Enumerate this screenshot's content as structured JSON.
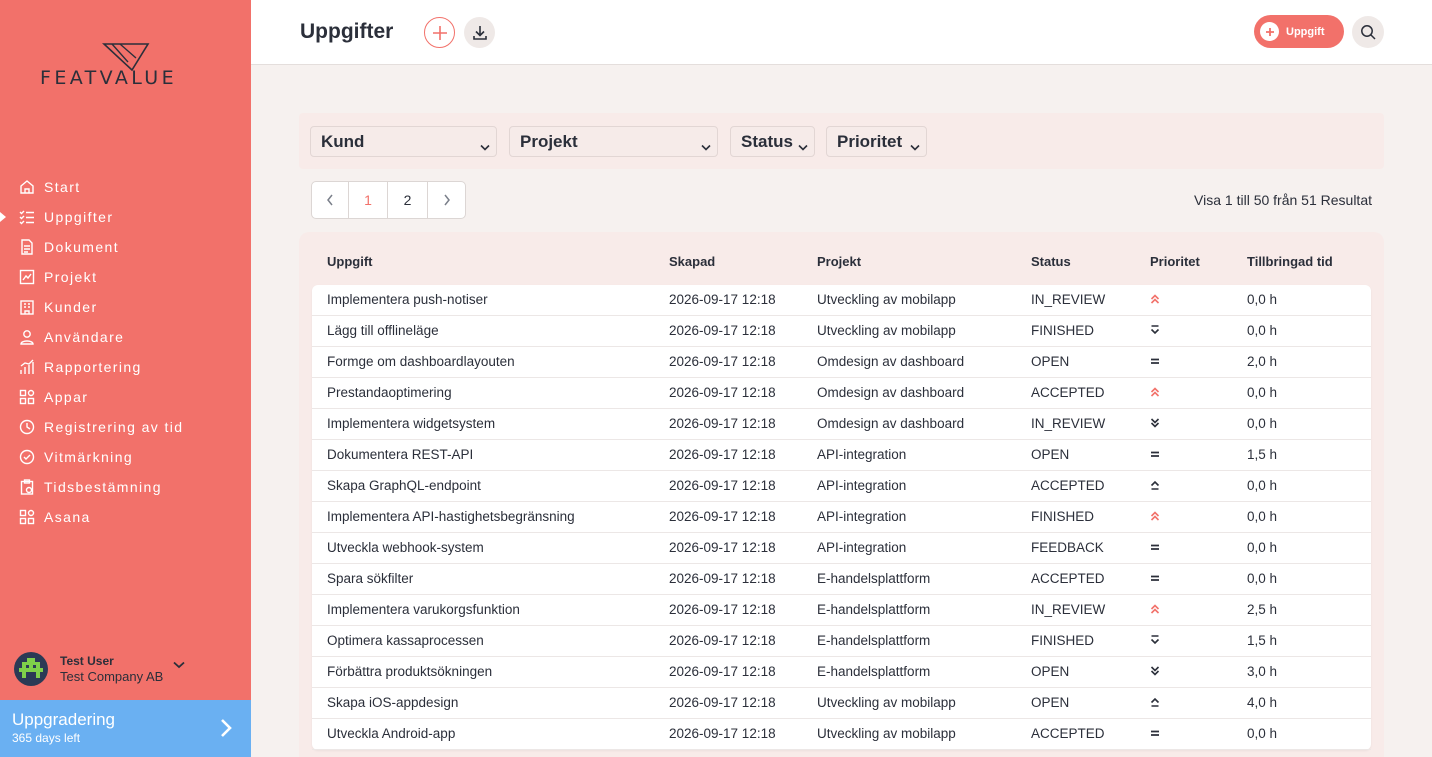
{
  "app": {
    "logo_text": "FEATVALUE"
  },
  "sidebar": {
    "items": [
      {
        "label": "Start",
        "icon": "home-icon"
      },
      {
        "label": "Uppgifter",
        "icon": "tasks-icon",
        "active": true
      },
      {
        "label": "Dokument",
        "icon": "document-icon"
      },
      {
        "label": "Projekt",
        "icon": "project-icon"
      },
      {
        "label": "Kunder",
        "icon": "customers-icon"
      },
      {
        "label": "Användare",
        "icon": "user-icon"
      },
      {
        "label": "Rapportering",
        "icon": "report-icon"
      },
      {
        "label": "Appar",
        "icon": "apps-icon"
      },
      {
        "label": "Registrering av tid",
        "icon": "timer-icon"
      },
      {
        "label": "Vitmärkning",
        "icon": "whitelabel-icon"
      },
      {
        "label": "Tidsbestämning",
        "icon": "clipboard-icon"
      },
      {
        "label": "Asana",
        "icon": "apps-icon"
      }
    ],
    "user": {
      "name": "Test User",
      "company": "Test Company AB"
    },
    "upgrade": {
      "title": "Uppgradering",
      "subtitle": "365 days left"
    }
  },
  "header": {
    "title": "Uppgifter",
    "task_button": "Uppgift"
  },
  "filters": {
    "customer": "Kund",
    "project": "Projekt",
    "status": "Status",
    "priority": "Prioritet"
  },
  "pagination": {
    "pages": [
      "1",
      "2"
    ],
    "current": "1",
    "results_text": "Visa 1 till 50 från 51 Resultat"
  },
  "colors": {
    "accent": "#f2716a",
    "upgrade": "#6ab0f2",
    "text": "#2b2f3a"
  },
  "table": {
    "columns": {
      "task": "Uppgift",
      "created": "Skapad",
      "project": "Projekt",
      "status": "Status",
      "priority": "Prioritet",
      "time": "Tillbringad tid"
    },
    "rows": [
      {
        "task": "Implementera push-notiser",
        "created": "2026-09-17 12:18",
        "project": "Utveckling av mobilapp",
        "status": "IN_REVIEW",
        "priority": "highest",
        "time": "0,0 h"
      },
      {
        "task": "Lägg till offlineläge",
        "created": "2026-09-17 12:18",
        "project": "Utveckling av mobilapp",
        "status": "FINISHED",
        "priority": "low",
        "time": "0,0 h"
      },
      {
        "task": "Formge om dashboardlayouten",
        "created": "2026-09-17 12:18",
        "project": "Omdesign av dashboard",
        "status": "OPEN",
        "priority": "medium",
        "time": "2,0 h"
      },
      {
        "task": "Prestandaoptimering",
        "created": "2026-09-17 12:18",
        "project": "Omdesign av dashboard",
        "status": "ACCEPTED",
        "priority": "highest",
        "time": "0,0 h"
      },
      {
        "task": "Implementera widgetsystem",
        "created": "2026-09-17 12:18",
        "project": "Omdesign av dashboard",
        "status": "IN_REVIEW",
        "priority": "lowest",
        "time": "0,0 h"
      },
      {
        "task": "Dokumentera REST-API",
        "created": "2026-09-17 12:18",
        "project": "API-integration",
        "status": "OPEN",
        "priority": "medium",
        "time": "1,5 h"
      },
      {
        "task": "Skapa GraphQL-endpoint",
        "created": "2026-09-17 12:18",
        "project": "API-integration",
        "status": "ACCEPTED",
        "priority": "high",
        "time": "0,0 h"
      },
      {
        "task": "Implementera API-hastighetsbegränsning",
        "created": "2026-09-17 12:18",
        "project": "API-integration",
        "status": "FINISHED",
        "priority": "highest",
        "time": "0,0 h"
      },
      {
        "task": "Utveckla webhook-system",
        "created": "2026-09-17 12:18",
        "project": "API-integration",
        "status": "FEEDBACK",
        "priority": "medium",
        "time": "0,0 h"
      },
      {
        "task": "Spara sökfilter",
        "created": "2026-09-17 12:18",
        "project": "E-handelsplattform",
        "status": "ACCEPTED",
        "priority": "medium",
        "time": "0,0 h"
      },
      {
        "task": "Implementera varukorgsfunktion",
        "created": "2026-09-17 12:18",
        "project": "E-handelsplattform",
        "status": "IN_REVIEW",
        "priority": "highest",
        "time": "2,5 h"
      },
      {
        "task": "Optimera kassaprocessen",
        "created": "2026-09-17 12:18",
        "project": "E-handelsplattform",
        "status": "FINISHED",
        "priority": "low",
        "time": "1,5 h"
      },
      {
        "task": "Förbättra produktsökningen",
        "created": "2026-09-17 12:18",
        "project": "E-handelsplattform",
        "status": "OPEN",
        "priority": "lowest",
        "time": "3,0 h"
      },
      {
        "task": "Skapa iOS-appdesign",
        "created": "2026-09-17 12:18",
        "project": "Utveckling av mobilapp",
        "status": "OPEN",
        "priority": "high",
        "time": "4,0 h"
      },
      {
        "task": "Utveckla Android-app",
        "created": "2026-09-17 12:18",
        "project": "Utveckling av mobilapp",
        "status": "ACCEPTED",
        "priority": "medium",
        "time": "0,0 h"
      }
    ]
  }
}
